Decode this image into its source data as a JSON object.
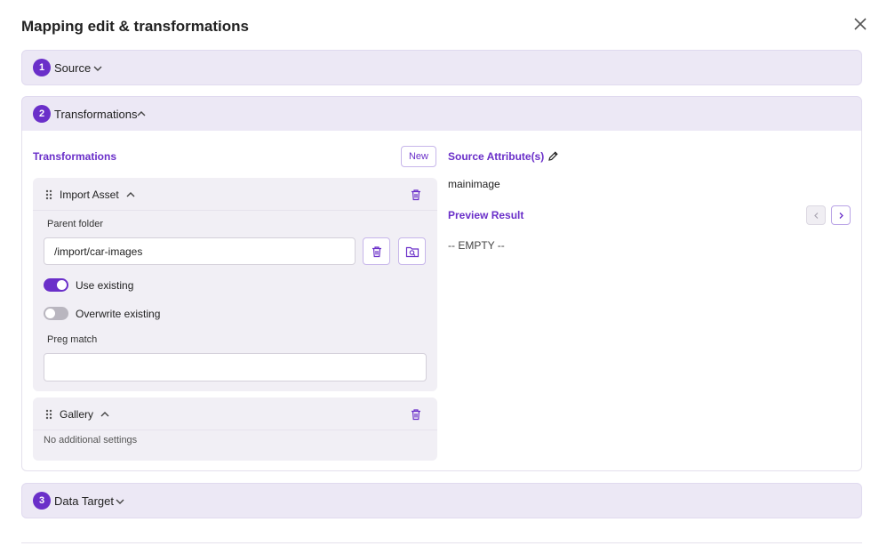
{
  "dialog": {
    "title": "Mapping edit & transformations"
  },
  "steps": [
    {
      "number": "1",
      "label": "Source"
    },
    {
      "number": "2",
      "label": "Transformations"
    },
    {
      "number": "3",
      "label": "Data Target"
    }
  ],
  "transformations": {
    "heading": "Transformations",
    "new_label": "New",
    "import_asset": {
      "title": "Import Asset",
      "parent_folder_label": "Parent folder",
      "parent_folder_value": "/import/car-images",
      "use_existing_label": "Use existing",
      "use_existing_on": true,
      "overwrite_existing_label": "Overwrite existing",
      "overwrite_existing_on": false,
      "preg_match_label": "Preg match",
      "preg_match_value": ""
    },
    "gallery": {
      "title": "Gallery",
      "note": "No additional settings"
    }
  },
  "source_attributes": {
    "heading": "Source Attribute(s)",
    "value": "mainimage"
  },
  "preview": {
    "heading": "Preview Result",
    "result": "-- EMPTY --"
  },
  "colors": {
    "accent": "#6a2fc9",
    "step_bg": "#ece8f5",
    "card_bg": "#f1eff5"
  },
  "icons": [
    "close-icon",
    "chevron-down-icon",
    "chevron-up-icon",
    "drag-handle-icon",
    "trash-icon",
    "folder-search-icon",
    "pencil-icon",
    "chevron-left-icon",
    "chevron-right-icon"
  ]
}
